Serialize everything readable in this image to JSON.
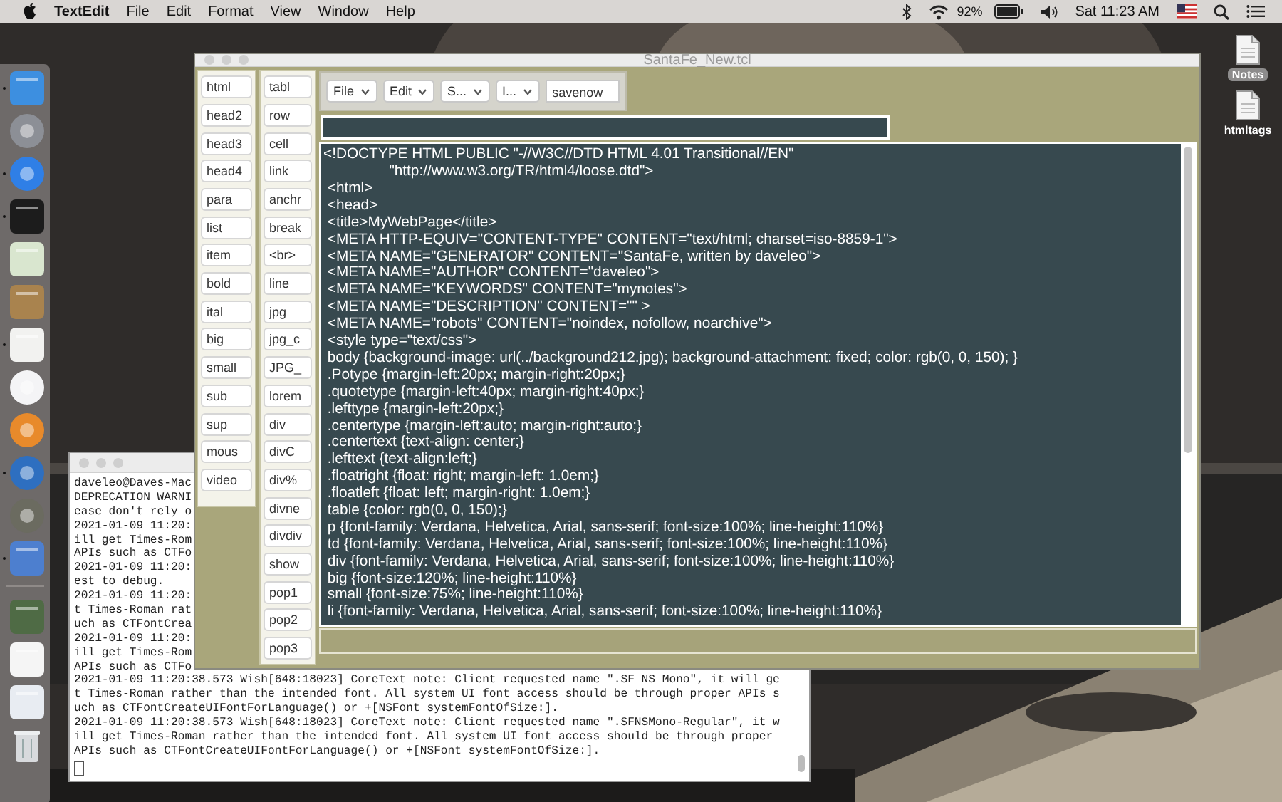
{
  "menu_bar": {
    "app_name": "TextEdit",
    "menus": [
      "File",
      "Edit",
      "Format",
      "View",
      "Window",
      "Help"
    ],
    "battery_reading": "92%",
    "clock": "Sat 11:23 AM"
  },
  "dock": {
    "items": [
      {
        "kind": "tile",
        "color": "#3d8fe0",
        "running": true
      },
      {
        "kind": "disc",
        "color": "#8c8f96",
        "running": false
      },
      {
        "kind": "disc",
        "color": "#2f7fe6",
        "running": true
      },
      {
        "kind": "tile",
        "color": "#1c1c1c",
        "running": true
      },
      {
        "kind": "tile",
        "color": "#d9e6cf",
        "running": false
      },
      {
        "kind": "tile",
        "color": "#a9834e",
        "running": false
      },
      {
        "kind": "tile",
        "color": "#f2f2f0",
        "running": true
      },
      {
        "kind": "disc",
        "color": "#f4f4f6",
        "running": false
      },
      {
        "kind": "disc",
        "color": "#e88a2b",
        "running": false
      },
      {
        "kind": "disc",
        "color": "#2e6fc0",
        "running": true
      },
      {
        "kind": "disc",
        "color": "#6b6b60",
        "running": false
      },
      {
        "kind": "tile",
        "color": "#4d7fcf",
        "running": true
      },
      {
        "kind": "divider"
      },
      {
        "kind": "tile",
        "color": "#4f6b45",
        "running": false
      },
      {
        "kind": "tile",
        "color": "#f5f5f5",
        "running": false
      },
      {
        "kind": "tile",
        "color": "#e8ecf2",
        "running": false
      },
      {
        "kind": "trash"
      }
    ]
  },
  "desktop_icons": [
    {
      "label": "Notes",
      "selected": true
    },
    {
      "label": "htmltags",
      "selected": false
    }
  ],
  "terminal": {
    "lines": [
      "daveleo@Daves-Mac",
      "DEPRECATION WARNI",
      "ease don't rely o",
      "2021-01-09 11:20:",
      "ill get Times-Rom",
      "APIs such as CTFo",
      "2021-01-09 11:20:",
      "est to debug.",
      "2021-01-09 11:20:",
      "t Times-Roman rat",
      "uch as CTFontCrea",
      "2021-01-09 11:20:",
      "ill get Times-Rom",
      "APIs such as CTFo",
      "2021-01-09 11:20:38.573 Wish[648:18023] CoreText note: Client requested name \".SF NS Mono\", it will ge",
      "t Times-Roman rather than the intended font. All system UI font access should be through proper APIs s",
      "uch as CTFontCreateUIFontForLanguage() or +[NSFont systemFontOfSize:].",
      "2021-01-09 11:20:38.573 Wish[648:18023] CoreText note: Client requested name \".SFNSMono-Regular\", it w",
      "ill get Times-Roman rather than the intended font. All system UI font access should be through proper",
      "APIs such as CTFontCreateUIFontForLanguage() or +[NSFont systemFontOfSize:]."
    ]
  },
  "editor_window": {
    "title": "SantaFe_New.tcl",
    "tag_buttons_1": [
      "html",
      "head2",
      "head3",
      "head4",
      "para",
      "list",
      "item",
      "bold",
      "ital",
      "big",
      "small",
      "sub",
      "sup",
      "mous",
      "video"
    ],
    "tag_buttons_2": [
      "tabl",
      "row",
      "cell",
      "link",
      "anchr",
      "break",
      "<br>",
      "line",
      "jpg",
      "jpg_c",
      "JPG_",
      "lorem",
      "div",
      "divC",
      "div%",
      "divne",
      "divdiv",
      "show",
      "pop1",
      "pop2",
      "pop3"
    ],
    "toolbar": {
      "menus": [
        "File",
        "Edit",
        "S...",
        "I..."
      ],
      "entry": "savenow"
    },
    "code_lines": [
      "<!DOCTYPE HTML PUBLIC \"-//W3C//DTD HTML 4.01 Transitional//EN\"",
      "                \"http://www.w3.org/TR/html4/loose.dtd\">",
      " <html>",
      " <head>",
      " <title>MyWebPage</title>",
      " <META HTTP-EQUIV=\"CONTENT-TYPE\" CONTENT=\"text/html; charset=iso-8859-1\">",
      " <META NAME=\"GENERATOR\" CONTENT=\"SantaFe, written by daveleo\">",
      " <META NAME=\"AUTHOR\" CONTENT=\"daveleo\">",
      " <META NAME=\"KEYWORDS\" CONTENT=\"mynotes\">",
      " <META NAME=\"DESCRIPTION\" CONTENT=\"\" >",
      " <META NAME=\"robots\" CONTENT=\"noindex, nofollow, noarchive\">",
      " <style type=\"text/css\">",
      " body {background-image: url(../background212.jpg); background-attachment: fixed; color: rgb(0, 0, 150); }",
      " .Potype {margin-left:20px; margin-right:20px;}",
      " .quotetype {margin-left:40px; margin-right:40px;}",
      " .lefttype {margin-left:20px;}",
      " .centertype {margin-left:auto; margin-right:auto;}",
      " .centertext {text-align: center;}",
      " .lefttext {text-align:left;}",
      " .floatright {float: right; margin-left: 1.0em;}",
      " .floatleft {float: left; margin-right: 1.0em;}",
      " table {color: rgb(0, 0, 150);}",
      " p {font-family: Verdana, Helvetica, Arial, sans-serif; font-size:100%; line-height:110%}",
      " td {font-family: Verdana, Helvetica, Arial, sans-serif; font-size:100%; line-height:110%}",
      " div {font-family: Verdana, Helvetica, Arial, sans-serif; font-size:100%; line-height:110%}",
      " big {font-size:120%; line-height:110%}",
      " small {font-size:75%; line-height:110%}",
      " li {font-family: Verdana, Helvetica, Arial, sans-serif; font-size:100%; line-height:110%}"
    ]
  }
}
